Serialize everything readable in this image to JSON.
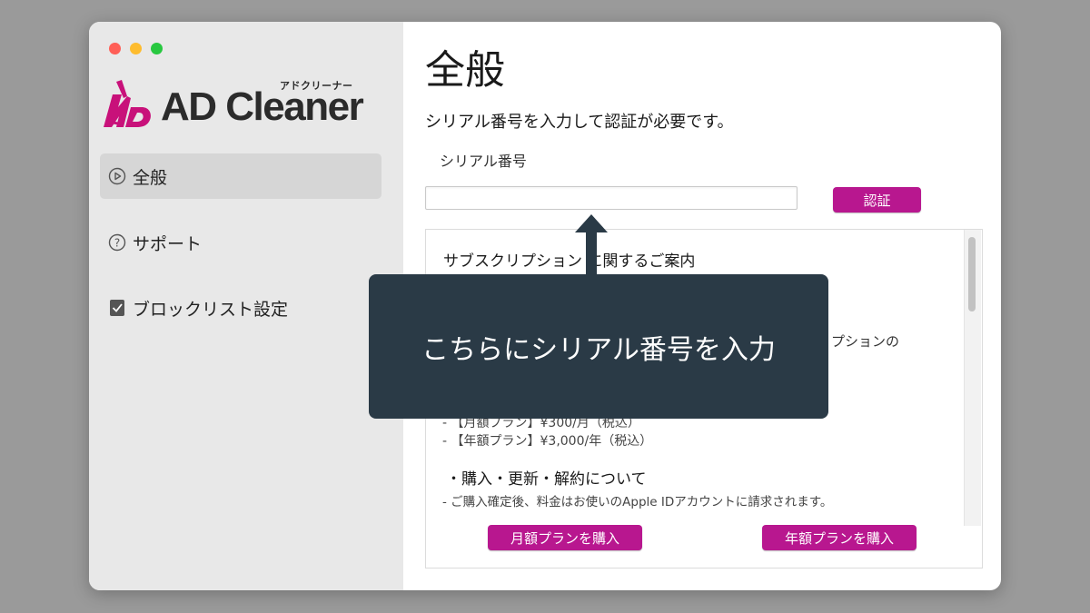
{
  "sidebar": {
    "logo": {
      "text": "AD Cleaner",
      "kana": "アドクリーナー"
    },
    "items": [
      {
        "label": "全般",
        "icon": "gear-icon",
        "active": true
      },
      {
        "label": "サポート",
        "icon": "question-icon",
        "active": false
      },
      {
        "label": "ブロックリスト設定",
        "icon": "checkbox-icon",
        "active": false
      }
    ]
  },
  "main": {
    "title": "全般",
    "subtitle": "シリアル番号を入力して認証が必要です。",
    "serial_label": "シリアル番号",
    "serial_value": "",
    "auth_button": "認証",
    "info": {
      "heading": "サブスクリプション に関するご案内",
      "partial_text": "プションの",
      "plans": [
        "- 【月額プラン】¥300/月（税込）",
        "- 【年額プラン】¥3,000/年（税込）"
      ],
      "section_title": "・購入・更新・解約について",
      "note": "- ご購入確定後、料金はお使いのApple IDアカウントに請求されます。",
      "buy_monthly": "月額プランを購入",
      "buy_yearly": "年額プランを購入"
    }
  },
  "callout": {
    "text": "こちらにシリアル番号を入力"
  },
  "colors": {
    "accent": "#b8178f",
    "callout_bg": "#2a3a46",
    "sidebar_bg": "#e8e8e8",
    "page_bg": "#9a9a9a"
  }
}
